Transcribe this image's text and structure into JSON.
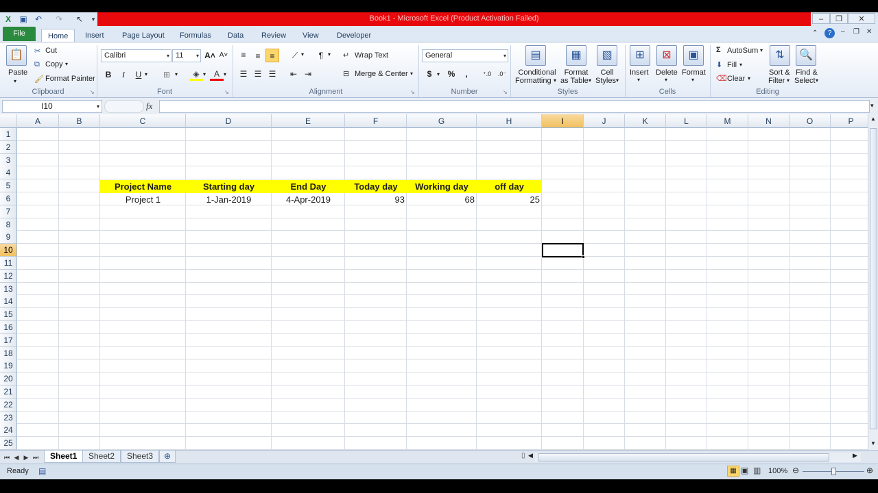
{
  "window": {
    "title": "Book1 - Microsoft Excel (Product Activation Failed)"
  },
  "tabs": [
    "File",
    "Home",
    "Insert",
    "Page Layout",
    "Formulas",
    "Data",
    "Review",
    "View",
    "Developer"
  ],
  "ribbon": {
    "clipboard": {
      "label": "Clipboard",
      "paste": "Paste",
      "cut": "Cut",
      "copy": "Copy",
      "format_painter": "Format Painter"
    },
    "font": {
      "label": "Font",
      "name": "Calibri",
      "size": "11",
      "bold": "B",
      "italic": "I",
      "underline": "U"
    },
    "alignment": {
      "label": "Alignment",
      "wrap_text": "Wrap Text",
      "merge_center": "Merge & Center"
    },
    "number": {
      "label": "Number",
      "format": "General",
      "currency": "$",
      "percent": "%",
      "comma": ","
    },
    "styles": {
      "label": "Styles",
      "conditional_1": "Conditional",
      "conditional_2": "Formatting",
      "format_table_1": "Format",
      "format_table_2": "as Table",
      "cell_styles_1": "Cell",
      "cell_styles_2": "Styles"
    },
    "cells": {
      "label": "Cells",
      "insert": "Insert",
      "delete": "Delete",
      "format": "Format"
    },
    "editing": {
      "label": "Editing",
      "autosum": "AutoSum",
      "fill": "Fill",
      "clear": "Clear",
      "sort_1": "Sort &",
      "sort_2": "Filter",
      "find_1": "Find &",
      "find_2": "Select"
    }
  },
  "formula_bar": {
    "name_box": "I10",
    "fx": "fx",
    "content": ""
  },
  "columns": [
    "A",
    "B",
    "C",
    "D",
    "E",
    "F",
    "G",
    "H",
    "I",
    "J",
    "K",
    "L",
    "M",
    "N",
    "O",
    "P"
  ],
  "selected_column": "I",
  "rows": [
    "1",
    "2",
    "3",
    "4",
    "5",
    "6",
    "7",
    "8",
    "9",
    "10",
    "11",
    "12",
    "13",
    "14",
    "15",
    "16",
    "17",
    "18",
    "19",
    "20",
    "21",
    "22",
    "23",
    "24",
    "25"
  ],
  "selected_row": "10",
  "table": {
    "headers": [
      "Project Name",
      "Starting day",
      "End Day",
      "Today day",
      "Working day",
      "off day"
    ],
    "row": [
      "Project 1",
      "1-Jan-2019",
      "4-Apr-2019",
      "93",
      "68",
      "25"
    ]
  },
  "sheets": [
    "Sheet1",
    "Sheet2",
    "Sheet3"
  ],
  "active_sheet": "Sheet1",
  "status": {
    "ready": "Ready",
    "zoom": "100%"
  },
  "colors": {
    "title_band": "#e8090c",
    "file_tab": "#2a8a3e",
    "header_fill": "#ffff00",
    "selection_header": "#f1c15f"
  }
}
